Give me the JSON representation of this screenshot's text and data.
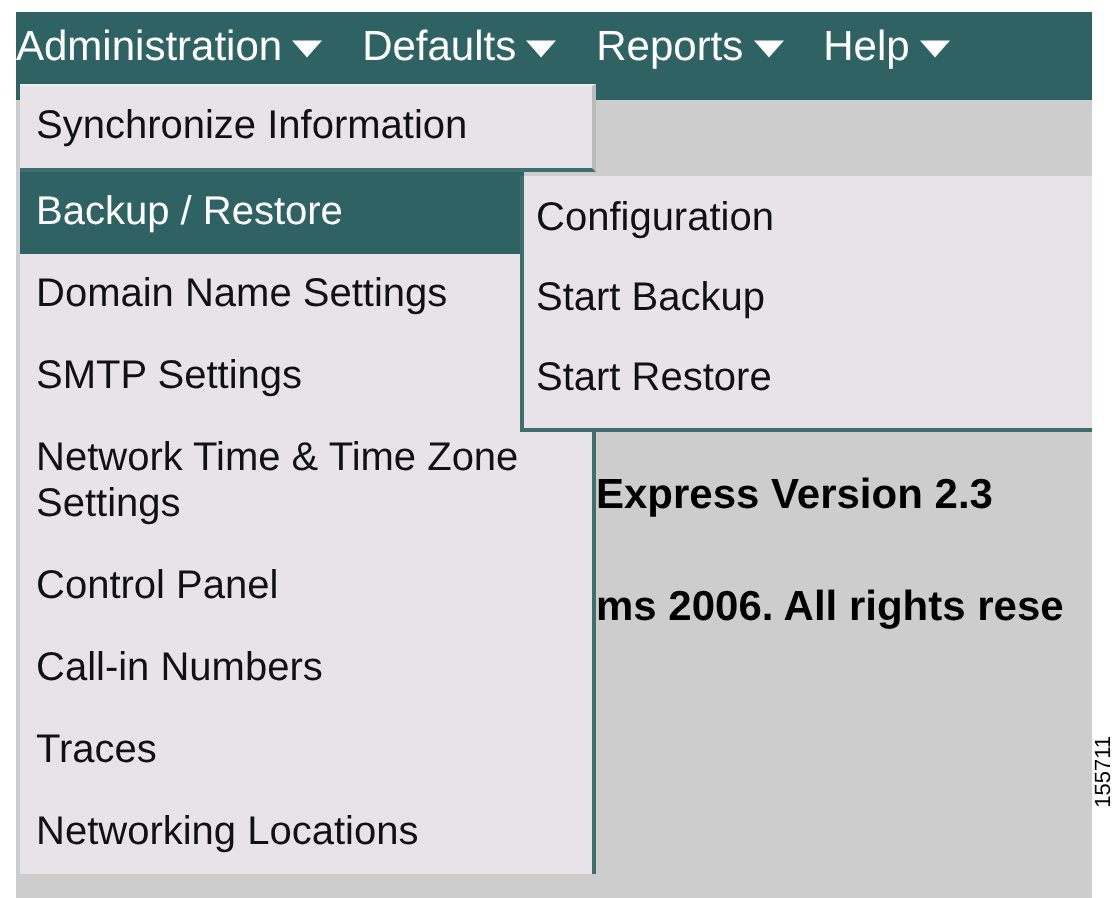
{
  "menu_bar": [
    {
      "label": "Administration"
    },
    {
      "label": "Defaults"
    },
    {
      "label": "Reports"
    },
    {
      "label": "Help"
    }
  ],
  "dropdown": {
    "items": [
      {
        "label": "Synchronize Information",
        "selected": false
      },
      {
        "label": "Backup / Restore",
        "selected": true
      },
      {
        "label": "Domain Name Settings",
        "selected": false
      },
      {
        "label": "SMTP Settings",
        "selected": false
      },
      {
        "label": "Network Time & Time Zone Settings",
        "selected": false
      },
      {
        "label": "Control Panel",
        "selected": false
      },
      {
        "label": "Call-in Numbers",
        "selected": false
      },
      {
        "label": "Traces",
        "selected": false
      },
      {
        "label": "Networking Locations",
        "selected": false
      }
    ]
  },
  "submenu": {
    "items": [
      {
        "label": "Configuration",
        "selected": false
      },
      {
        "label": "Start Backup",
        "selected": false
      },
      {
        "label": "Start Restore",
        "selected": false
      }
    ]
  },
  "content": {
    "version_text": "Express Version 2.3",
    "copyright_text": "ms 2006. All rights rese"
  },
  "figure_number": "155711"
}
